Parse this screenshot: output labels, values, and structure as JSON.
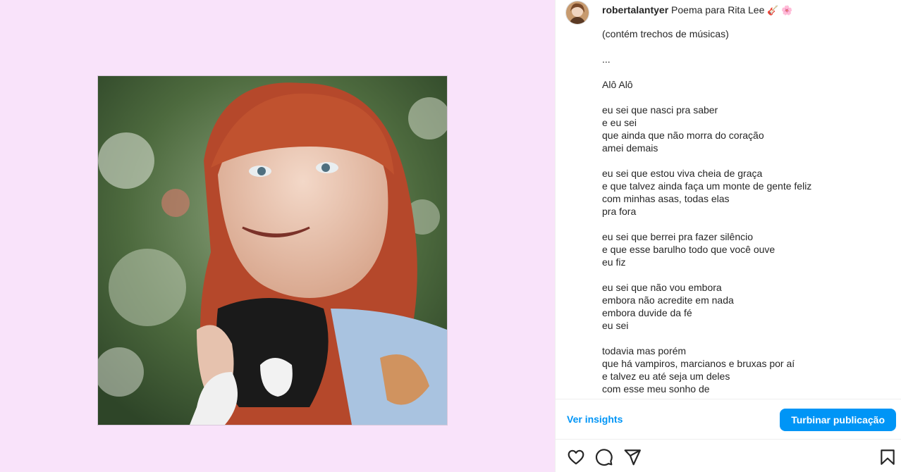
{
  "post": {
    "username": "robertalantyer",
    "title": "Poema para Rita Lee",
    "title_emojis": "🎸 🌸",
    "caption_lines": [
      "(contém trechos de músicas)",
      "",
      "...",
      "",
      "Alô Alô",
      "",
      "eu sei que nasci pra saber",
      "e eu sei",
      "que ainda que não morra do coração",
      "amei demais",
      "",
      "eu sei que estou viva cheia de graça",
      "e que talvez ainda faça um monte de gente feliz",
      "com minhas asas, todas elas",
      "pra fora",
      "",
      "eu sei que berrei pra fazer silêncio",
      "e que esse barulho todo que você ouve",
      "eu fiz",
      "",
      "eu sei que não vou embora",
      "embora não acredite em nada",
      "embora duvide da fé",
      "eu sei",
      "",
      "todavia mas porém",
      "que há vampiros, marcianos e bruxas por aí",
      "e talvez eu até seja um deles",
      "com esse meu sonho de"
    ]
  },
  "actions": {
    "insights_label": "Ver insights",
    "boost_label": "Turbinar publicação"
  },
  "icons": {
    "like": "heart-icon",
    "comment": "comment-icon",
    "share": "send-icon",
    "save": "bookmark-icon"
  },
  "colors": {
    "media_background": "#f9e3fa",
    "accent": "#0095f6"
  }
}
